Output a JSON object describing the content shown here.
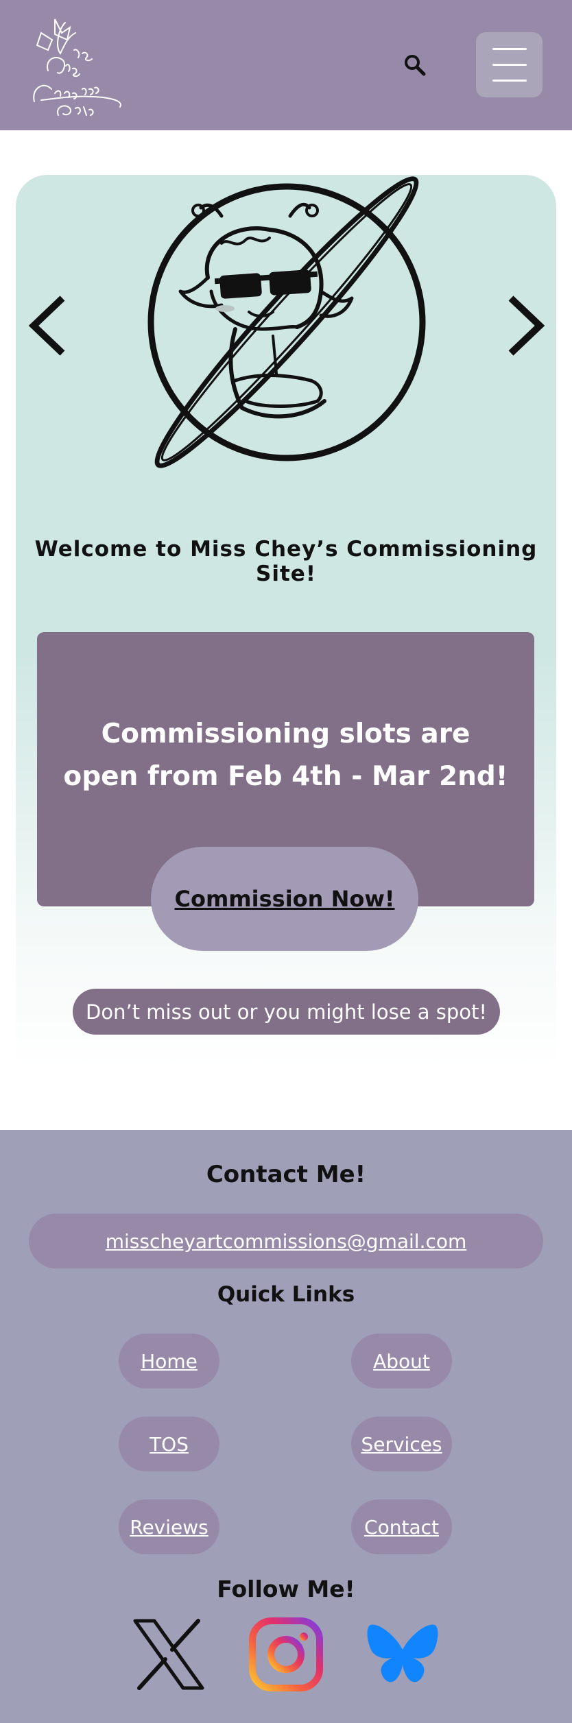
{
  "header": {
    "logo_text": "Miss Chey's Commissioning Site"
  },
  "hero": {
    "welcome": "Welcome to Miss Chey’s Commissioning Site!",
    "slots_line1": "Commissioning slots are",
    "slots_line2": "open from Feb 4th - Mar 2nd!",
    "cta_label": "Commission Now!",
    "warning": "Don’t miss out or you might lose a spot!"
  },
  "footer": {
    "contact_title": "Contact Me!",
    "email": "misscheyartcommissions@gmail.com",
    "quick_links_title": "Quick Links",
    "links": [
      {
        "label": "Home"
      },
      {
        "label": "About"
      },
      {
        "label": "TOS"
      },
      {
        "label": "Services"
      },
      {
        "label": "Reviews"
      },
      {
        "label": "Contact"
      }
    ],
    "follow_title": "Follow Me!",
    "socials": [
      "x-icon",
      "instagram-icon",
      "bluesky-icon"
    ]
  },
  "colors": {
    "header_bg": "#978aa8",
    "hero_bg": "#cfe7e3",
    "accent_purple": "#827088",
    "button_lavender": "#a39bb6",
    "footer_bg": "#a09fb8",
    "bluesky_blue": "#1185fe"
  }
}
